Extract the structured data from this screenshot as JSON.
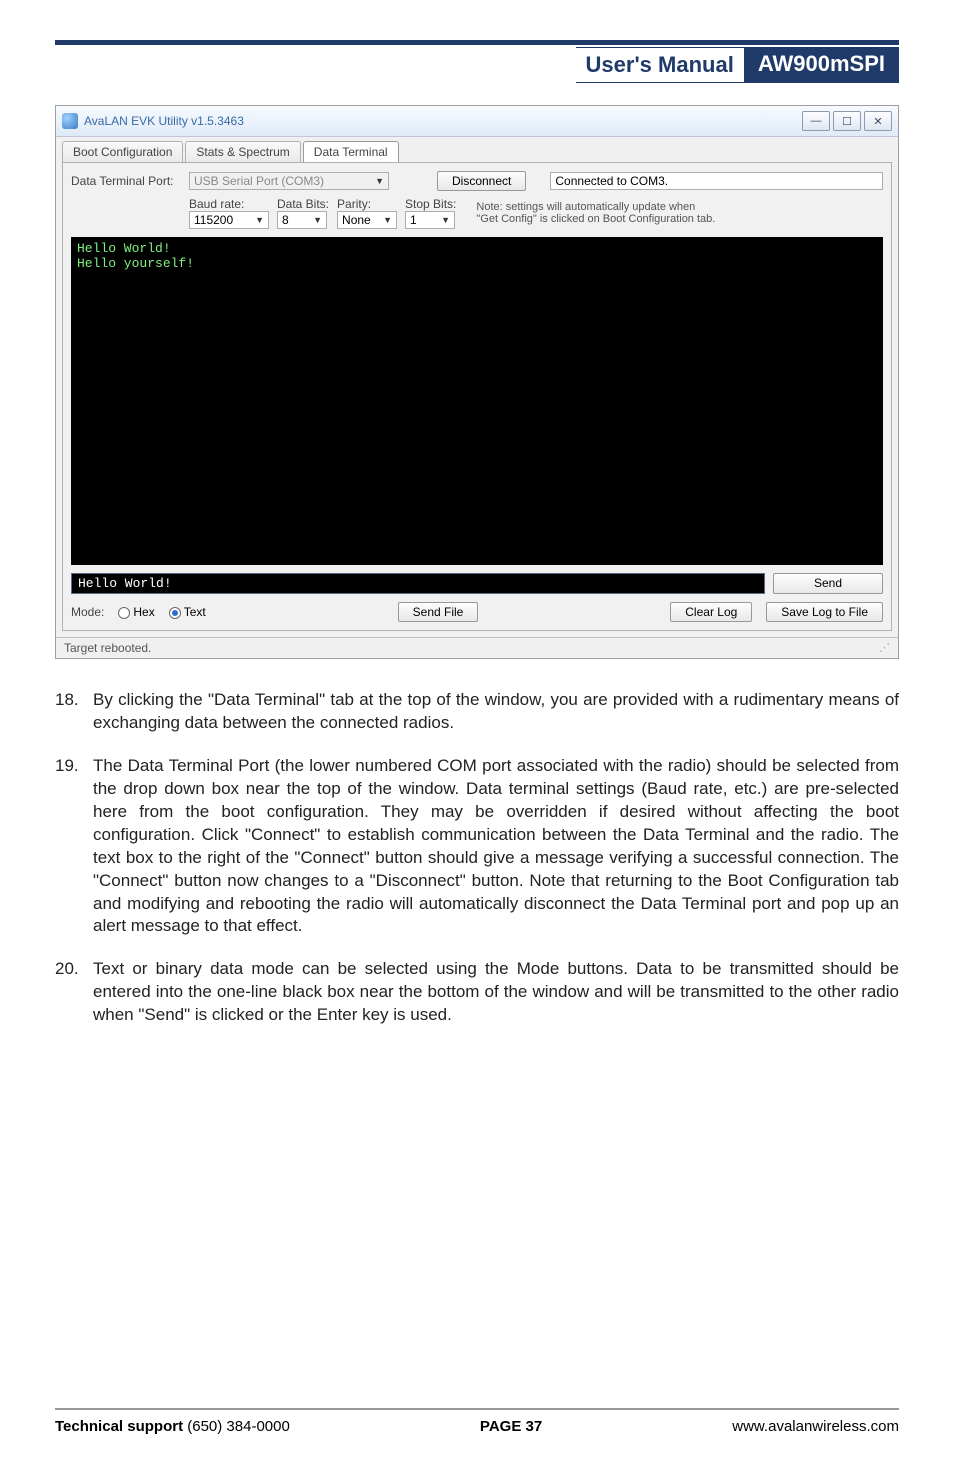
{
  "header": {
    "label": "User's Manual",
    "model": "AW900mSPI"
  },
  "window": {
    "title": "AvaLAN EVK Utility v1.5.3463",
    "tabs": [
      "Boot Configuration",
      "Stats & Spectrum",
      "Data Terminal"
    ],
    "active_tab": "Data Terminal",
    "port_label": "Data Terminal Port:",
    "port_combo": "USB Serial Port (COM3)",
    "disconnect_btn": "Disconnect",
    "status_text": "Connected to COM3.",
    "baud_label": "Baud rate:",
    "baud_value": "115200",
    "databits_label": "Data Bits:",
    "databits_value": "8",
    "parity_label": "Parity:",
    "parity_value": "None",
    "stopbits_label": "Stop Bits:",
    "stopbits_value": "1",
    "note_line1": "Note: settings will automatically update when",
    "note_line2": "\"Get Config\" is clicked on Boot Configuration tab.",
    "terminal_out": "Hello World!\nHello yourself!",
    "terminal_in": "Hello World!",
    "send_btn": "Send",
    "mode_label": "Mode:",
    "mode_hex": "Hex",
    "mode_text": "Text",
    "sendfile_btn": "Send File",
    "clearlog_btn": "Clear Log",
    "savelog_btn": "Save Log to File",
    "statusbar": "Target rebooted."
  },
  "paragraphs": {
    "p18n": "18.",
    "p18": "By clicking the \"Data Terminal\" tab at the top of the window, you are provided with a rudimentary means of exchanging data between the connected radios.",
    "p19n": "19.",
    "p19": " The Data Terminal Port (the lower numbered COM port associated with the radio) should be selected from the drop down box near the top of the window. Data terminal settings (Baud rate, etc.) are pre-selected here from the boot configuration. They may be overridden if desired without affecting the boot configuration. Click \"Connect\" to establish communication between the Data Terminal and the radio. The text box to the right of the \"Connect\" button should give a message verifying a successful connection. The \"Connect\" button now changes to a \"Disconnect\" button. Note that returning to the Boot Configuration tab and modifying and rebooting the radio will automatically disconnect the Data Terminal port and pop up an alert message to that effect.",
    "p20n": "20.",
    "p20": "Text or binary data mode can be selected using the Mode buttons. Data to be transmitted should be entered into the one-line black box near the bottom of the window and will be transmitted to the other radio when \"Send\" is clicked or the Enter key is used."
  },
  "footer": {
    "left_bold": "Technical support",
    "left_rest": " (650) 384-0000",
    "center": "PAGE 37",
    "right": "www.avalanwireless.com"
  }
}
